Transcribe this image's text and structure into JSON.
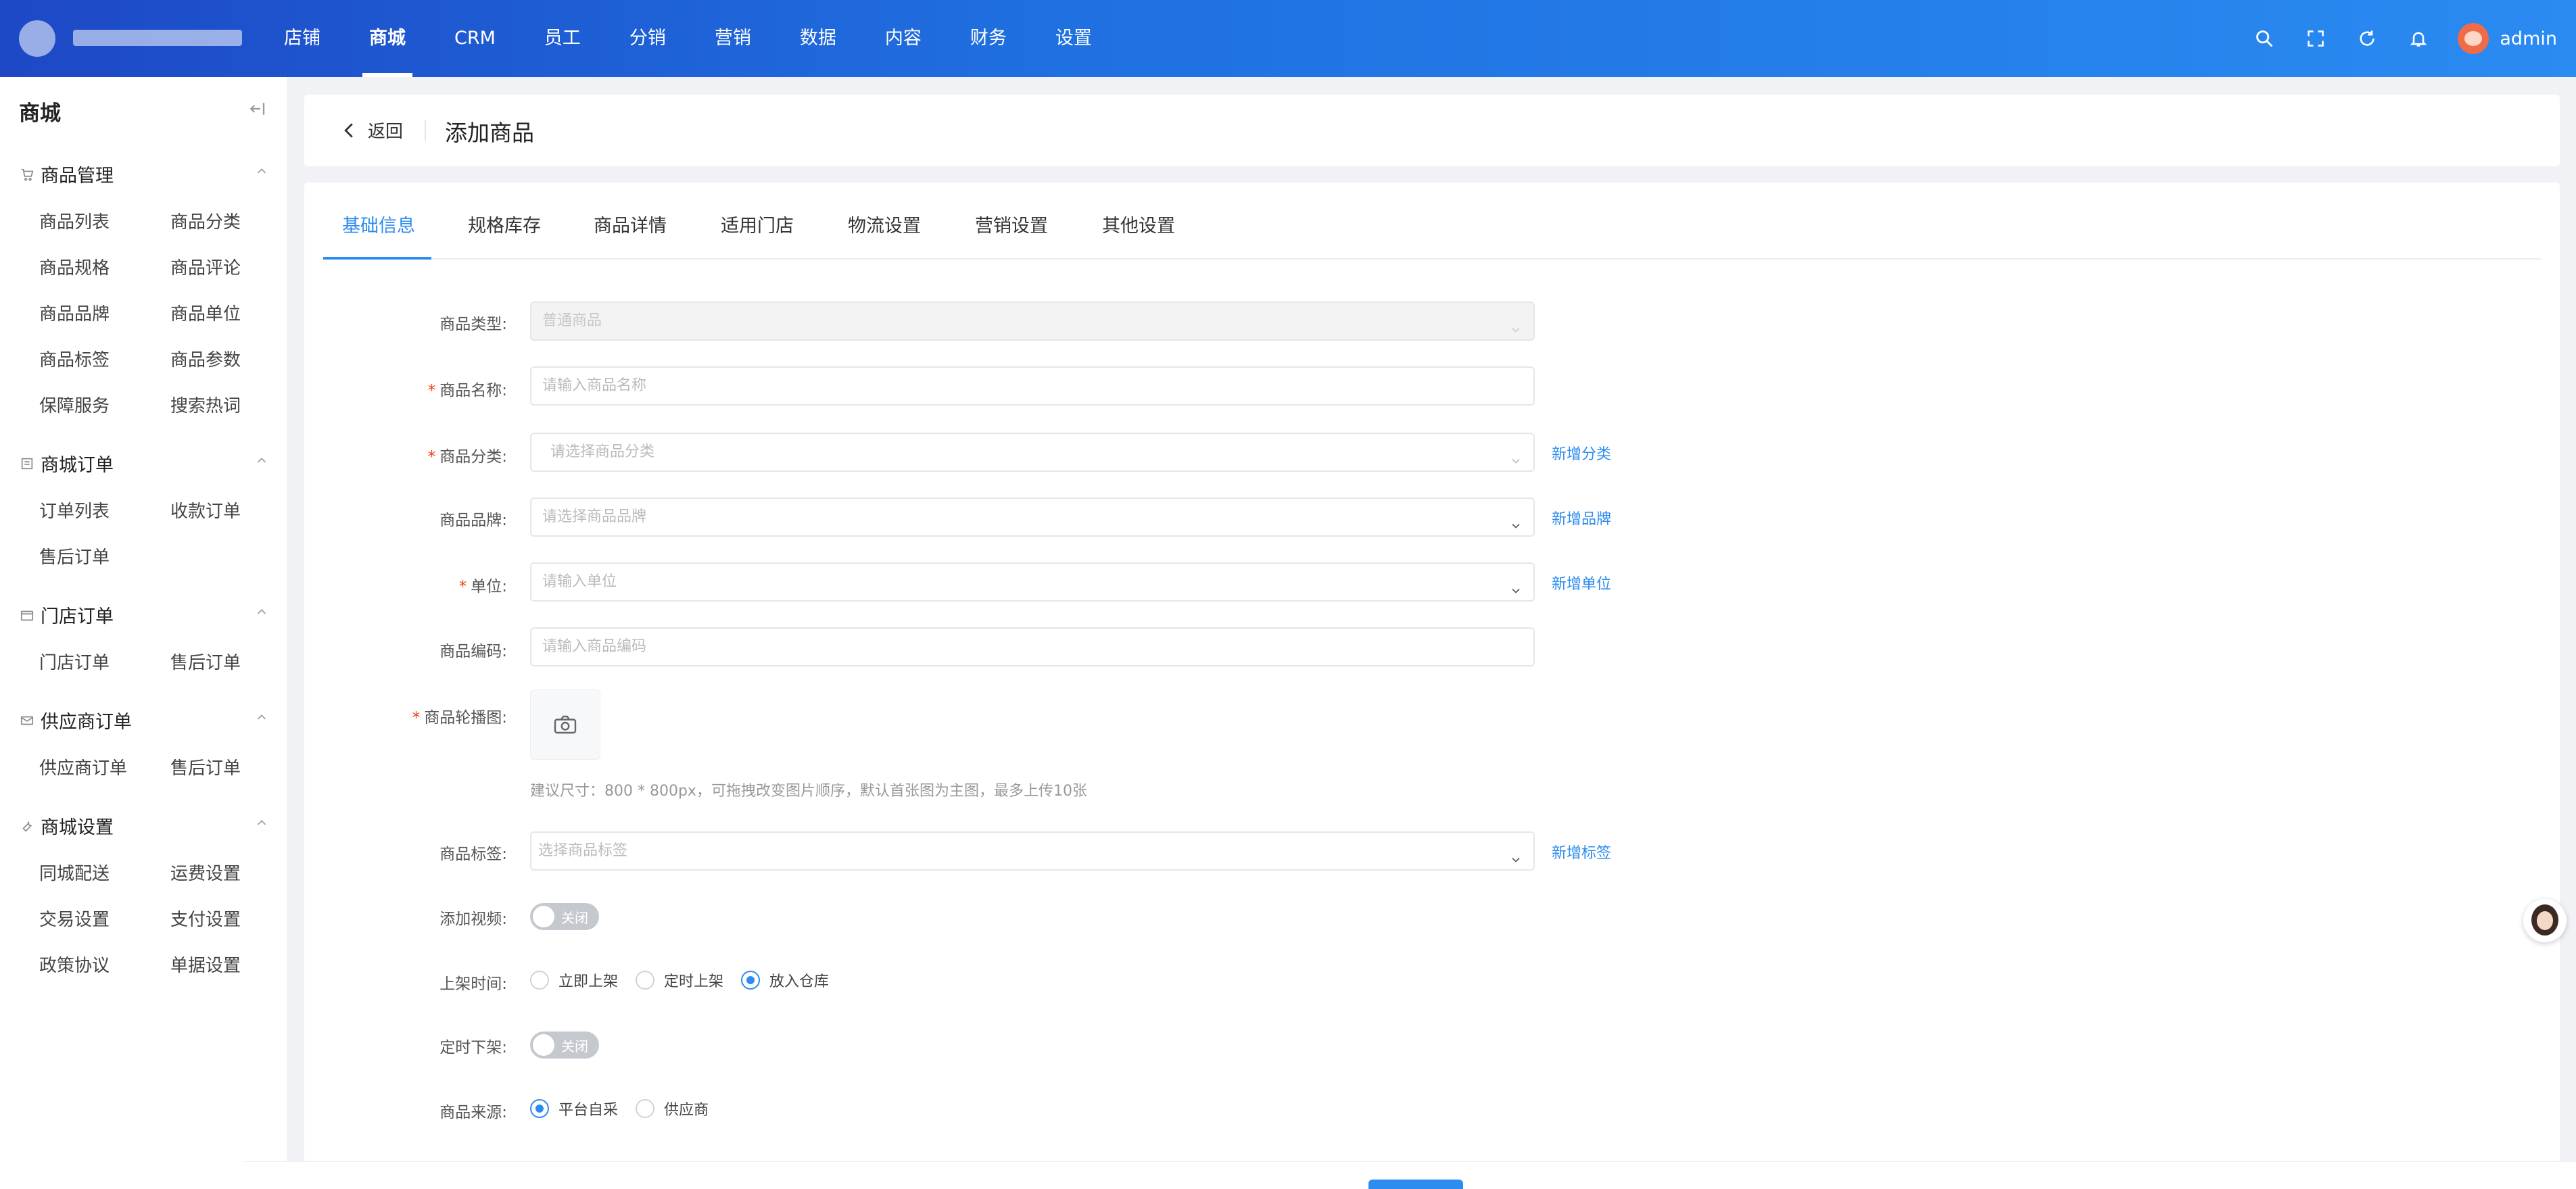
{
  "topbar": {
    "nav": [
      "店铺",
      "商城",
      "CRM",
      "员工",
      "分销",
      "营销",
      "数据",
      "内容",
      "财务",
      "设置"
    ],
    "active_index": 1,
    "user": "admin",
    "icons": [
      "search-icon",
      "fullscreen-icon",
      "refresh-icon",
      "bell-icon"
    ]
  },
  "sidebar": {
    "title": "商城",
    "groups": [
      {
        "name": "商品管理",
        "icon": "cart-icon",
        "items": [
          "商品列表",
          "商品分类",
          "商品规格",
          "商品评论",
          "商品品牌",
          "商品单位",
          "商品标签",
          "商品参数",
          "保障服务",
          "搜索热词"
        ]
      },
      {
        "name": "商城订单",
        "icon": "list-icon",
        "items": [
          "订单列表",
          "收款订单",
          "售后订单"
        ]
      },
      {
        "name": "门店订单",
        "icon": "store-icon",
        "items": [
          "门店订单",
          "售后订单"
        ]
      },
      {
        "name": "供应商订单",
        "icon": "mail-icon",
        "items": [
          "供应商订单",
          "售后订单"
        ]
      },
      {
        "name": "商城设置",
        "icon": "wrench-icon",
        "items": [
          "同城配送",
          "运费设置",
          "交易设置",
          "支付设置",
          "政策协议",
          "单据设置"
        ]
      }
    ]
  },
  "header": {
    "back": "返回",
    "title": "添加商品"
  },
  "tabs": [
    "基础信息",
    "规格库存",
    "商品详情",
    "适用门店",
    "物流设置",
    "营销设置",
    "其他设置"
  ],
  "form": {
    "type": {
      "label": "商品类型:",
      "value": "普通商品"
    },
    "name": {
      "label": "商品名称:",
      "placeholder": "请输入商品名称"
    },
    "category": {
      "label": "商品分类:",
      "placeholder": "请选择商品分类",
      "link": "新增分类"
    },
    "brand": {
      "label": "商品品牌:",
      "placeholder": "请选择商品品牌",
      "link": "新增品牌"
    },
    "unit": {
      "label": "单位:",
      "placeholder": "请输入单位",
      "link": "新增单位"
    },
    "code": {
      "label": "商品编码:",
      "placeholder": "请输入商品编码"
    },
    "carousel": {
      "label": "商品轮播图:",
      "hint": "建议尺寸：800 * 800px，可拖拽改变图片顺序，默认首张图为主图，最多上传10张"
    },
    "tags": {
      "label": "商品标签:",
      "placeholder": "选择商品标签",
      "link": "新增标签"
    },
    "video": {
      "label": "添加视频:",
      "switch_text": "关闭"
    },
    "shelf_time": {
      "label": "上架时间:",
      "options": [
        "立即上架",
        "定时上架",
        "放入仓库"
      ],
      "selected": 2
    },
    "auto_off": {
      "label": "定时下架:",
      "switch_text": "关闭"
    },
    "source": {
      "label": "商品来源:",
      "options": [
        "平台自采",
        "供应商"
      ],
      "selected": 0
    }
  },
  "colors": {
    "primary": "#2d8cf0",
    "topbar_start": "#1e48c6",
    "topbar_end": "#2a8bf2",
    "required": "#ed4014"
  }
}
